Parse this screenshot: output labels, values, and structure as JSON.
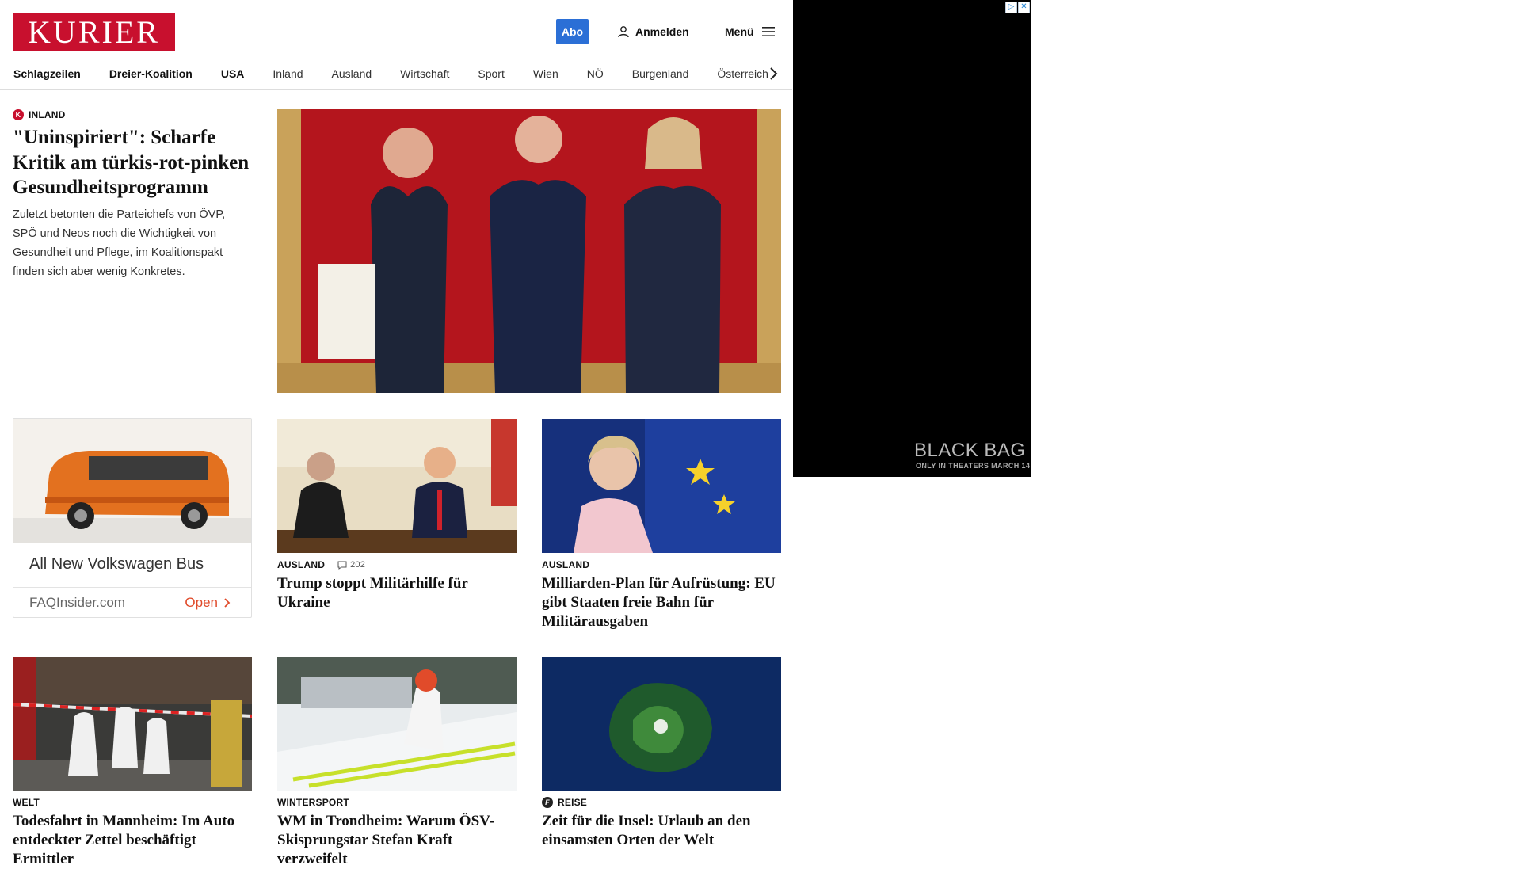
{
  "header": {
    "logo": "KURIER",
    "abo_label": "Abo",
    "login_label": "Anmelden",
    "menu_label": "Menü",
    "brand_color": "#c8102e"
  },
  "nav": {
    "items": [
      "Schlagzeilen",
      "Dreier-Koalition",
      "USA",
      "Inland",
      "Ausland",
      "Wirtschaft",
      "Sport",
      "Wien",
      "NÖ",
      "Burgenland",
      "Österreich"
    ]
  },
  "lead": {
    "kicker": "INLAND",
    "headline": "\"Uninspiriert\": Scharfe Kritik am türkis-rot-pinken Gesundheitsprogramm",
    "teaser": "Zuletzt betonten die Parteichefs von ÖVP, SPÖ und Neos noch die Wichtigkeit von Gesundheit und Pflege, im Koalitionspakt finden sich aber wenig Konkretes."
  },
  "ad_card": {
    "title": "All New Volkswagen Bus",
    "domain": "FAQInsider.com",
    "cta": "Open"
  },
  "articles": [
    {
      "kicker": "AUSLAND",
      "comments": "202",
      "headline": "Trump stoppt Militärhilfe für Ukraine"
    },
    {
      "kicker": "AUSLAND",
      "headline": "Milliarden-Plan für Aufrüstung: EU gibt Staaten freie Bahn für Militärausgaben"
    },
    {
      "kicker": "WELT",
      "headline": "Todesfahrt in Mannheim: Im Auto entdeckter Zettel beschäftigt Ermittler"
    },
    {
      "kicker": "WINTERSPORT",
      "headline": "WM in Trondheim: Warum ÖSV-Skisprungstar Stefan Kraft verzweifelt"
    },
    {
      "kicker": "REISE",
      "headline": "Zeit für die Insel: Urlaub an den einsamsten Orten der Welt"
    }
  ],
  "side_ad": {
    "title": "BLACK BAG",
    "tagline": "ONLY IN THEATERS MARCH 14"
  }
}
